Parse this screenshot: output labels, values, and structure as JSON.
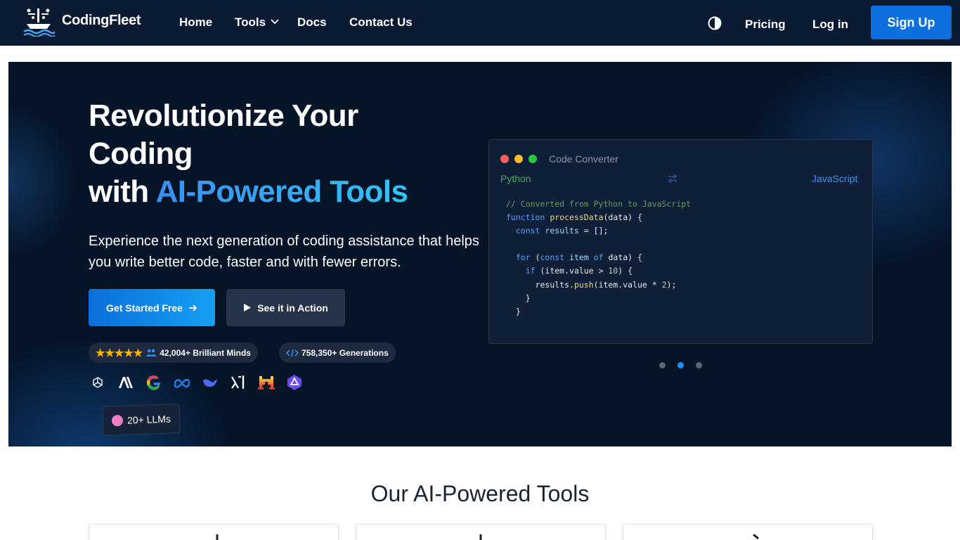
{
  "nav": {
    "brand": "CodingFleet",
    "links": [
      "Home",
      "Tools",
      "Docs",
      "Contact Us"
    ],
    "pricing": "Pricing",
    "login": "Log in",
    "signup": "Sign Up"
  },
  "hero": {
    "title_line1": "Revolutionize Your",
    "title_line2": "Coding",
    "title_line3_prefix": "with",
    "title_line3_highlight": "AI-Powered Tools",
    "subtitle": "Experience the next generation of coding assistance that helps you write better code, faster and with fewer errors.",
    "cta_primary": "Get Started Free",
    "cta_secondary": "See it in Action",
    "stat_users": "42,004+ Brilliant Minds",
    "stat_generations": "758,350+ Generations",
    "llm_badge": "20+ LLMs",
    "rating_stars": 5,
    "llm_icons": [
      "openai-icon",
      "anthropic-icon",
      "google-icon",
      "meta-icon",
      "deepseek-icon",
      "xai-icon",
      "mistral-icon",
      "qwen-icon"
    ]
  },
  "code_card": {
    "title": "Code Converter",
    "from_lang": "Python",
    "to_lang": "JavaScript",
    "lines": [
      "// Converted from Python to JavaScript",
      "function processData(data) {",
      "  const results = [];",
      "",
      "  for (const item of data) {",
      "    if (item.value > 10) {",
      "      results.push(item.value * 2);",
      "    }",
      "  }"
    ],
    "carousel_active": 2
  },
  "section": {
    "title": "Our AI-Powered Tools"
  },
  "colors": {
    "nav_bg": "#0b1a33",
    "hero_bg": "#061428",
    "accent": "#0b6fdd",
    "highlight": "#2fc4f4"
  }
}
